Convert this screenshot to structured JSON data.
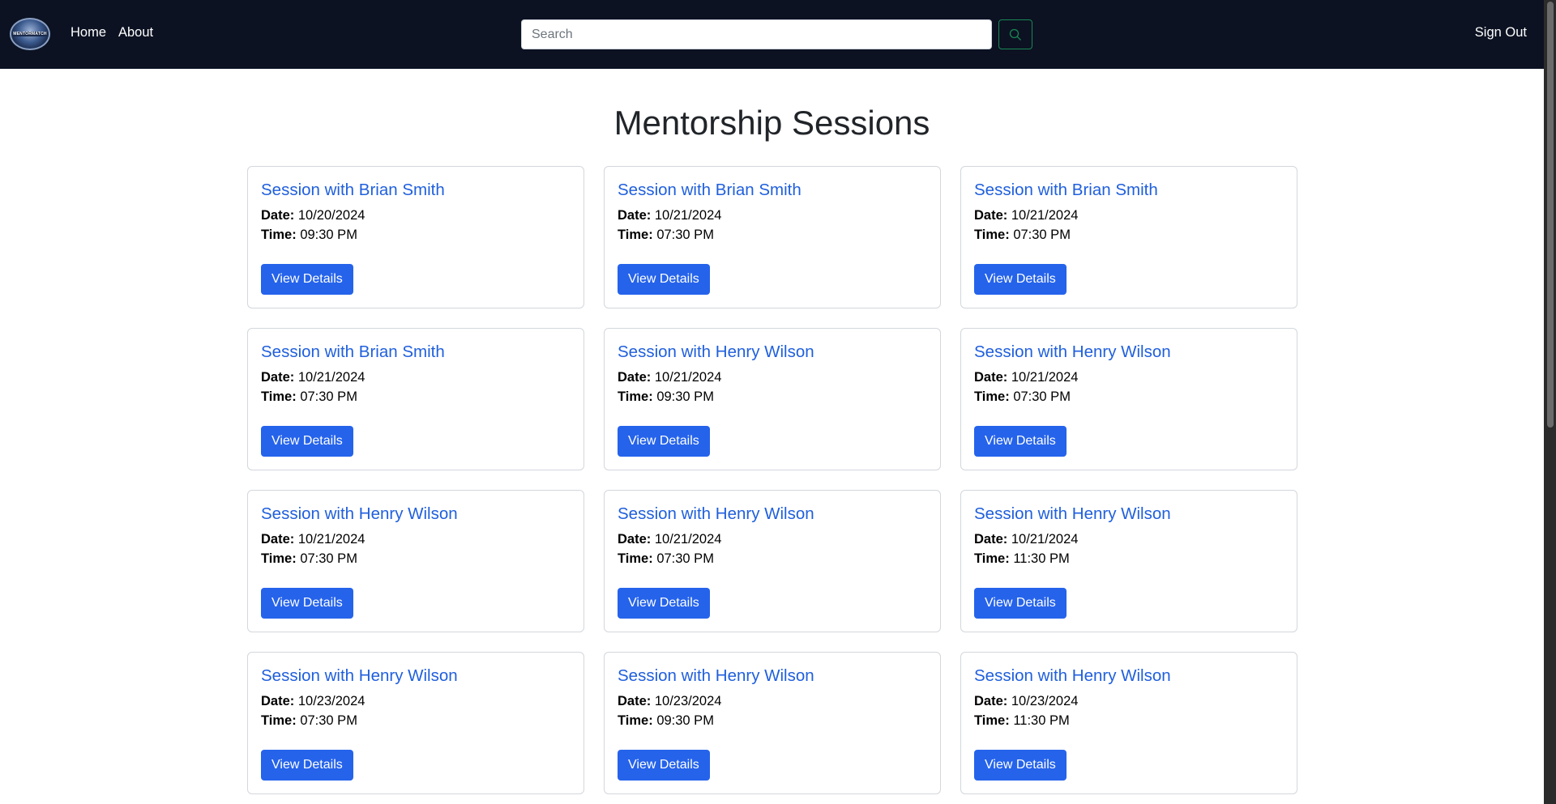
{
  "nav": {
    "logo_text": "MENTORMATCH",
    "home_label": "Home",
    "about_label": "About",
    "search_placeholder": "Search",
    "search_icon": "search-icon",
    "signout_label": "Sign Out"
  },
  "main": {
    "title": "Mentorship Sessions",
    "date_label": "Date:",
    "time_label": "Time:",
    "button_label": "View Details",
    "sessions": [
      {
        "title": "Session with Brian Smith",
        "date": "10/20/2024",
        "time": "09:30 PM"
      },
      {
        "title": "Session with Brian Smith",
        "date": "10/21/2024",
        "time": "07:30 PM"
      },
      {
        "title": "Session with Brian Smith",
        "date": "10/21/2024",
        "time": "07:30 PM"
      },
      {
        "title": "Session with Brian Smith",
        "date": "10/21/2024",
        "time": "07:30 PM"
      },
      {
        "title": "Session with Henry Wilson",
        "date": "10/21/2024",
        "time": "09:30 PM"
      },
      {
        "title": "Session with Henry Wilson",
        "date": "10/21/2024",
        "time": "07:30 PM"
      },
      {
        "title": "Session with Henry Wilson",
        "date": "10/21/2024",
        "time": "07:30 PM"
      },
      {
        "title": "Session with Henry Wilson",
        "date": "10/21/2024",
        "time": "07:30 PM"
      },
      {
        "title": "Session with Henry Wilson",
        "date": "10/21/2024",
        "time": "11:30 PM"
      },
      {
        "title": "Session with Henry Wilson",
        "date": "10/23/2024",
        "time": "07:30 PM"
      },
      {
        "title": "Session with Henry Wilson",
        "date": "10/23/2024",
        "time": "09:30 PM"
      },
      {
        "title": "Session with Henry Wilson",
        "date": "10/23/2024",
        "time": "11:30 PM"
      }
    ]
  },
  "colors": {
    "navbar_bg": "#0c1222",
    "link_blue": "#1f5fdd",
    "button_blue": "#2563eb",
    "search_btn_border": "#198754"
  }
}
